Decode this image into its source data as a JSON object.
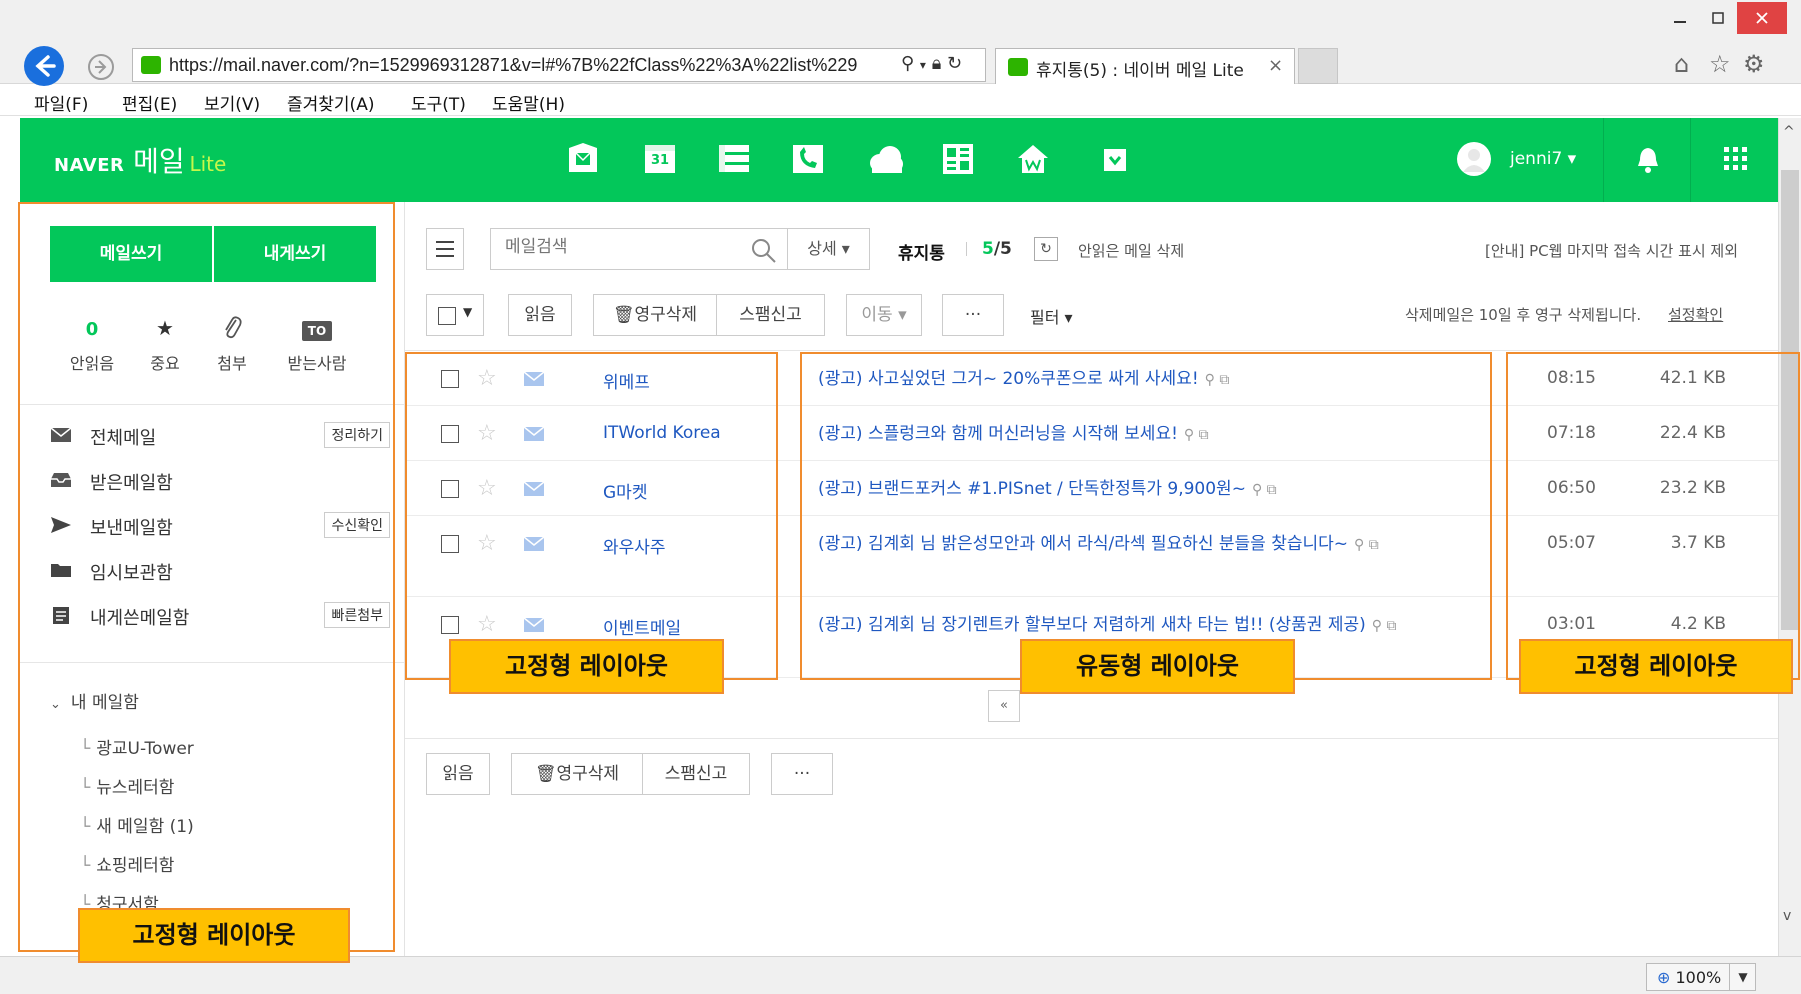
{
  "browser": {
    "url": "https://mail.naver.com/?n=1529969312871&v=l#%7B%22fClass%22%3A%22list%229",
    "tab_title": "휴지통(5) : 네이버 메일 Lite",
    "tab_close": "×",
    "menu": [
      "파일(F)",
      "편집(E)",
      "보기(V)",
      "즐겨찾기(A)",
      "도구(T)",
      "도움말(H)"
    ],
    "zoom": "100%"
  },
  "header": {
    "logo_naver": "NAVER",
    "logo_mail": "메일",
    "logo_lite": "Lite",
    "user": "jenni7 ▾",
    "brand_color": "#03c75a",
    "app_icons": [
      "mail-app-icon",
      "calendar-app-icon",
      "memo-app-icon",
      "contacts-app-icon",
      "cloud-app-icon",
      "office-app-icon",
      "blog-app-icon",
      "more-app-icon"
    ],
    "calendar_day": "31"
  },
  "sidebar": {
    "write_label": "메일쓰기",
    "selfwrite_label": "내게쓰기",
    "quick": {
      "unread_count": "0",
      "unread_label": "안읽음",
      "important_label": "중요",
      "attach_label": "첨부",
      "to_badge": "TO",
      "to_label": "받는사람"
    },
    "folders": [
      {
        "label": "전체메일",
        "button": "정리하기"
      },
      {
        "label": "받은메일함",
        "button": ""
      },
      {
        "label": "보낸메일함",
        "button": "수신확인"
      },
      {
        "label": "임시보관함",
        "button": ""
      },
      {
        "label": "내게쓴메일함",
        "button": "빠른첨부"
      }
    ],
    "my_mailbox": "내 메일함",
    "subfolders": [
      "광교U-Tower",
      "뉴스레터함",
      "새 메일함 (1)",
      "쇼핑레터함",
      "청구서함"
    ]
  },
  "toolbar": {
    "search_placeholder": "메일검색",
    "detail": "상세 ▾",
    "folder_title": "휴지통",
    "count_unread": "5",
    "count_total": "/5",
    "delete_unread": "안읽은 메일 삭제",
    "notice": "[안내] PC웹 마지막 접속 시간 표시 제외",
    "read": "읽음",
    "perm_delete": "영구삭제",
    "spam": "스팸신고",
    "move": "이동 ▾",
    "more": "···",
    "filter": "필터 ▾",
    "auto_delete_note": "삭제메일은 10일 후 영구 삭제됩니다.",
    "settings_link": "설정확인"
  },
  "mails": [
    {
      "sender": "위메프",
      "subject": "(광고) 사고싶었던 그거~ 20%쿠폰으로 싸게 사세요!",
      "time": "08:15",
      "size": "42.1 KB"
    },
    {
      "sender": "ITWorld Korea",
      "subject": "(광고) 스플렁크와 함께 머신러닝을 시작해 보세요!",
      "time": "07:18",
      "size": "22.4 KB"
    },
    {
      "sender": "G마켓",
      "subject": "(광고) 브랜드포커스 #1.PISnet / 단독한정특가 9,900원~",
      "time": "06:50",
      "size": "23.2 KB"
    },
    {
      "sender": "와우사주",
      "subject": "(광고) 김계회 님 밝은성모안과 에서 라식/라섹 필요하신 분들을 찾습니다~",
      "time": "05:07",
      "size": "3.7 KB"
    },
    {
      "sender": "이벤트메일",
      "subject": "(광고) 김계회 님 장기렌트카 할부보다 저렴하게 새차 타는 법!! (상품권 제공)",
      "time": "03:01",
      "size": "4.2 KB"
    }
  ],
  "pager": "«",
  "annotations": {
    "fixed": "고정형 레이아웃",
    "fluid": "유동형 레이아웃",
    "highlight_color": "#ffc000",
    "border_color": "#f08c2e"
  }
}
